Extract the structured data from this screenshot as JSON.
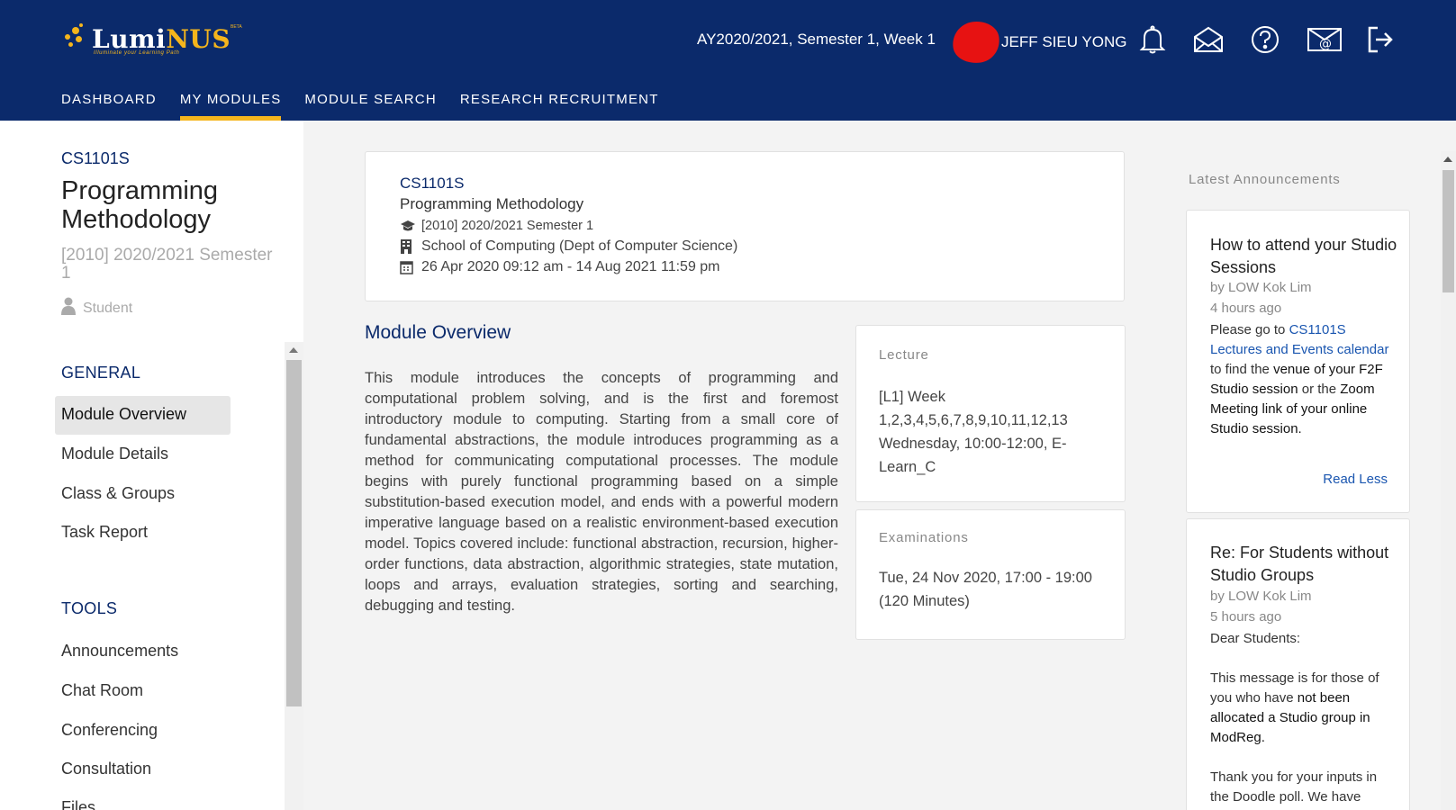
{
  "brand": {
    "lumi": "Lumi",
    "nus": "NUS",
    "tagline": "Illuminate your Learning Path",
    "beta": "BETA"
  },
  "header": {
    "semester": "AY2020/2021, Semester 1, Week 1",
    "user_name": "JEFF SIEU YONG",
    "icons": [
      "bell-icon",
      "mail-icon",
      "help-icon",
      "email-at-icon",
      "logout-icon"
    ]
  },
  "nav": {
    "items": [
      {
        "label": "DASHBOARD"
      },
      {
        "label": "MY MODULES"
      },
      {
        "label": "MODULE SEARCH"
      },
      {
        "label": "RESEARCH RECRUITMENT"
      }
    ]
  },
  "sidebar": {
    "code": "CS1101S",
    "title": "Programming Methodology",
    "semester": "[2010] 2020/2021 Semester 1",
    "role": "Student",
    "general_heading": "GENERAL",
    "general_items": [
      "Module Overview",
      "Module Details",
      "Class & Groups",
      "Task Report"
    ],
    "tools_heading": "TOOLS",
    "tools_items": [
      "Announcements",
      "Chat Room",
      "Conferencing",
      "Consultation",
      "Files"
    ]
  },
  "info": {
    "code": "CS1101S",
    "title": "Programming Methodology",
    "term": "[2010] 2020/2021 Semester 1",
    "faculty": "School of Computing (Dept of Computer Science)",
    "dates": "26 Apr 2020 09:12 am - 14 Aug 2021 11:59 pm"
  },
  "overview": {
    "heading": "Module Overview",
    "body": "This module introduces the concepts of programming and computational problem solving, and is the first and foremost introductory module to computing. Starting from a small core of fundamental abstractions, the module introduces programming as a method for communicating computational processes. The module begins with purely functional programming based on a simple substitution-based execution model, and ends with a powerful modern imperative language based on a realistic environment-based execution model. Topics covered include: functional abstraction, recursion, higher-order functions, data abstraction, algorithmic strategies, state mutation, loops and arrays, evaluation strategies, sorting and searching, debugging and testing."
  },
  "lecture": {
    "heading": "Lecture",
    "line1": "[L1] Week",
    "line2": "1,2,3,4,5,6,7,8,9,10,11,12,13",
    "line3": "Wednesday, 10:00-12:00, E-",
    "line4": "Learn_C"
  },
  "exam": {
    "heading": "Examinations",
    "line1": "Tue, 24 Nov 2020, 17:00 - 19:00",
    "line2": "(120 Minutes)"
  },
  "announcements": {
    "heading": "Latest Announcements",
    "items": [
      {
        "title": "How to attend your Studio Sessions",
        "author": "by LOW Kok Lim",
        "time": "4 hours ago",
        "t1": "Please go to ",
        "link": "CS1101S Lectures and Events calendar",
        "t2": " to find the ",
        "b1": "venue of your F2F Studio session",
        "t3": " or the ",
        "b2": "Zoom Meeting link of your online Studio session.",
        "action": "Read Less"
      },
      {
        "title": "Re: For Students without Studio Groups",
        "author": "by LOW Kok Lim",
        "time": "5 hours ago",
        "p1": "Dear Students:",
        "p2a": "This message is for those of you who have ",
        "p2b": "not been allocated a Studio group in ModReg.",
        "p3": "Thank you for your inputs in the Doodle poll.  We have"
      }
    ]
  },
  "colors": {
    "header_bg": "#0b2a6b",
    "accent": "#f5b51c",
    "link": "#1a56b0",
    "avatar": "#e71212"
  }
}
